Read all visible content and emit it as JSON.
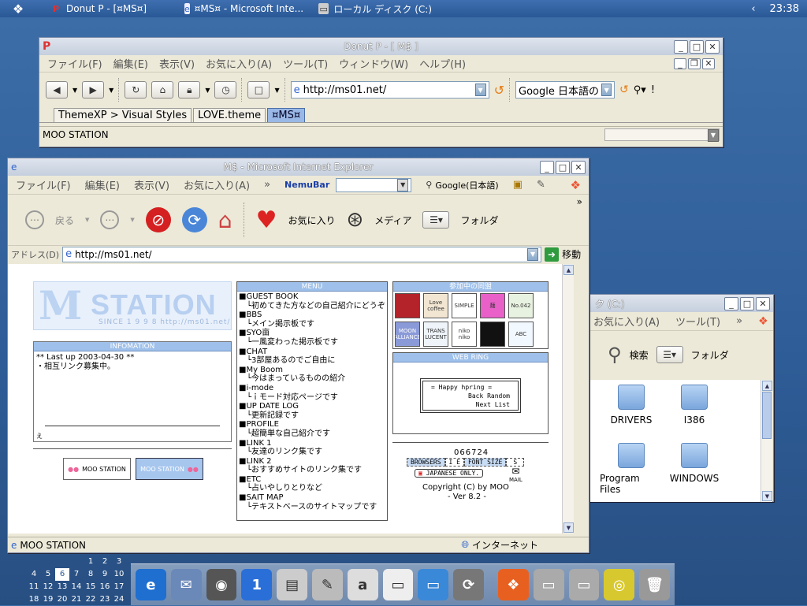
{
  "taskbar": {
    "tasks": [
      {
        "label": "Donut P - [¤MS¤]"
      },
      {
        "label": "¤MS¤ - Microsoft Inte..."
      },
      {
        "label": "ローカル ディスク (C:)"
      }
    ],
    "time": "23:38"
  },
  "donut": {
    "title": "Donut P - [ M$ ]",
    "menu": [
      "ファイル(F)",
      "編集(E)",
      "表示(V)",
      "お気に入り(A)",
      "ツール(T)",
      "ウィンドウ(W)",
      "ヘルプ(H)"
    ],
    "address": "http://ms01.net/",
    "search_value": "Google 日本語の^",
    "tabs": [
      "ThemeXP > Visual Styles",
      "LOVE.theme",
      "¤MS¤"
    ],
    "status": "MOO STATION"
  },
  "ie": {
    "title": "M$ - Microsoft Internet Explorer",
    "menu": [
      "ファイル(F)",
      "編集(E)",
      "表示(V)",
      "お気に入り(A)"
    ],
    "nemubar": "NemuBar",
    "google_label": "Google(日本語)",
    "toolbar": {
      "back": "戻る",
      "favorites": "お気に入り",
      "media": "メディア",
      "folders": "フォルダ"
    },
    "address_label": "アドレス(D)",
    "address": "http://ms01.net/",
    "go": "移動",
    "status_left": "MOO STATION",
    "status_zone": "インターネット"
  },
  "site": {
    "logo_letter": "M",
    "logo_word": "STATION",
    "logo_since": "SINCE 1 9 9 8    http://ms01.net/",
    "info_header": "INFOMATION",
    "info_lines": [
      "** Last up 2003-04-30 **",
      "・相互リンク募集中。"
    ],
    "info_footer": "え",
    "banner1": "MOO STATION",
    "banner2": "MOO STATION",
    "menu_header": "MENU",
    "menu": [
      {
        "title": "■GUEST BOOK",
        "sub": "└初めてきた方などの自己紹介にどうぞ"
      },
      {
        "title": "■BBS",
        "sub": "└メイン掲示板です"
      },
      {
        "title": "■SYO亩",
        "sub": "└一風変わった掲示板です"
      },
      {
        "title": "■CHAT",
        "sub": "└3部屋あるのでご自由に"
      },
      {
        "title": "■My Boom",
        "sub": "└今はまっているものの紹介"
      },
      {
        "title": "■i-mode",
        "sub": "└ｉモード対応ページです"
      },
      {
        "title": "■UP DATE LOG",
        "sub": "└更新記録です"
      },
      {
        "title": "■PROFILE",
        "sub": "└超簡単な自己紹介です"
      },
      {
        "title": "■LINK 1",
        "sub": "└友達のリンク集です"
      },
      {
        "title": "■LINK 2",
        "sub": "└おすすめサイトのリンク集です"
      },
      {
        "title": "■ETC",
        "sub": "└占いやしりとりなど"
      },
      {
        "title": "■SAIT MAP",
        "sub": "└テキストベースのサイトマップです"
      }
    ],
    "join_header": "参加中の同盟",
    "join_icons": [
      {
        "label": "",
        "color": "#b4222a"
      },
      {
        "label": "Love coffee",
        "color": "#f2e6d2"
      },
      {
        "label": "SIMPLE",
        "color": "#ffffff"
      },
      {
        "label": "麺",
        "color": "#e860c8"
      },
      {
        "label": "No.042",
        "color": "#e8f2e0"
      },
      {
        "label": "MOON ALLIANCE",
        "color": "#8a9ad8"
      },
      {
        "label": "TRANS LUCENT",
        "color": "#eef4fa"
      },
      {
        "label": "niko niko",
        "color": "#ffffff"
      },
      {
        "label": "",
        "color": "#111111"
      },
      {
        "label": "ABC",
        "color": "#f2f8ff"
      }
    ],
    "webring_header": "WEB RING",
    "webring_lines": [
      "= Happy hpring =",
      "Back Random",
      "Next List"
    ],
    "counter": "066724",
    "badges": [
      "BROWSERS",
      "I E",
      "FONT SIZE",
      "S"
    ],
    "japanese": "JAPANESE ONLY.",
    "mail": "MAIL",
    "copyright": "Copyright (C) by MOO",
    "version": "- Ver 8.2 -"
  },
  "explorer": {
    "title": "ク (C:)",
    "menu": [
      "お気に入り(A)",
      "ツール(T)"
    ],
    "search": "検索",
    "folders": "フォルダ",
    "items": [
      "DRIVERS",
      "I386",
      "Program Files",
      "WINDOWS"
    ],
    "partial_left": "s"
  },
  "calendar": {
    "rows": [
      [
        "",
        "",
        "",
        "",
        "1",
        "2",
        "3"
      ],
      [
        "4",
        "5",
        "6",
        "7",
        "8",
        "9",
        "10"
      ],
      [
        "11",
        "12",
        "13",
        "14",
        "15",
        "16",
        "17"
      ],
      [
        "18",
        "19",
        "20",
        "21",
        "22",
        "23",
        "24"
      ]
    ],
    "today": "6"
  },
  "dock": {
    "icons": [
      "ie-icon",
      "mail-icon",
      "media-icon",
      "one-icon",
      "ipod-icon",
      "pen-icon",
      "font-icon",
      "paper-icon",
      "monitor-icon",
      "sync-icon",
      "windows-icon",
      "drive-icon",
      "drive2-icon",
      "cd-icon",
      "trash-icon"
    ]
  }
}
